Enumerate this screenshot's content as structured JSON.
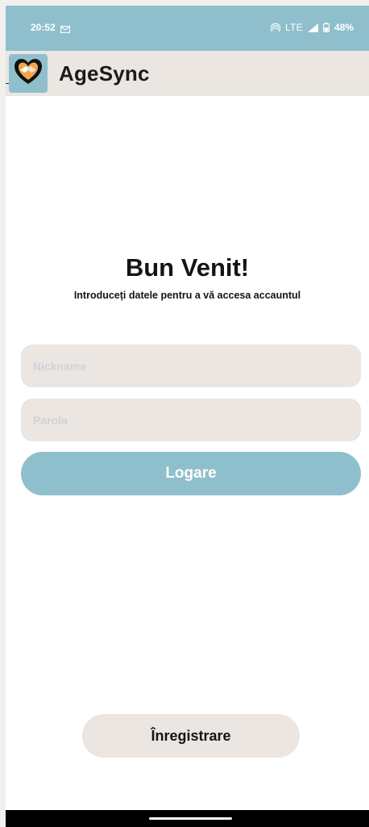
{
  "status_bar": {
    "time": "20:52",
    "network": "LTE",
    "battery": "48%",
    "left_icons": [
      "gmail-icon"
    ],
    "right_icons": [
      "hotspot-icon",
      "signal-icon",
      "battery-icon"
    ]
  },
  "app_bar": {
    "title": "AgeSync",
    "logo_icon": "handshake-heart-icon"
  },
  "welcome": {
    "title": "Bun Venit!",
    "subtitle": "Introduceți datele pentru a vă accesa accauntul"
  },
  "form": {
    "nickname_placeholder": "Nickname",
    "nickname_value": "",
    "password_placeholder": "Parola",
    "password_value": "",
    "login_label": "Logare"
  },
  "register": {
    "label": "Înregistrare"
  },
  "colors": {
    "accent": "#8fbfcc",
    "surface": "#ebe6e2",
    "text": "#141414",
    "placeholder": "#d5cfd8"
  }
}
